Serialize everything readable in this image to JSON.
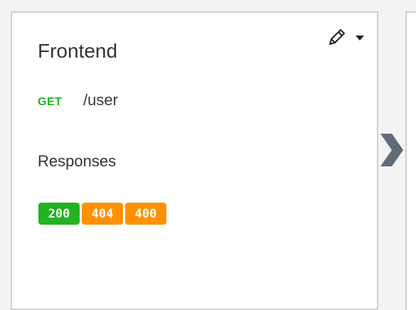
{
  "card": {
    "title": "Frontend",
    "method": "GET",
    "path": "/user",
    "responses_title": "Responses",
    "responses": [
      {
        "code": "200",
        "color": "#22b322"
      },
      {
        "code": "404",
        "color": "#ff9100"
      },
      {
        "code": "400",
        "color": "#ff9100"
      }
    ]
  },
  "icons": {
    "edit": "pencil-icon",
    "dropdown": "caret-down-icon",
    "next": "chevron-right-icon"
  },
  "colors": {
    "method_get": "#22b322",
    "success": "#22b322",
    "warning": "#ff9100",
    "arrow": "#5f6b78"
  }
}
